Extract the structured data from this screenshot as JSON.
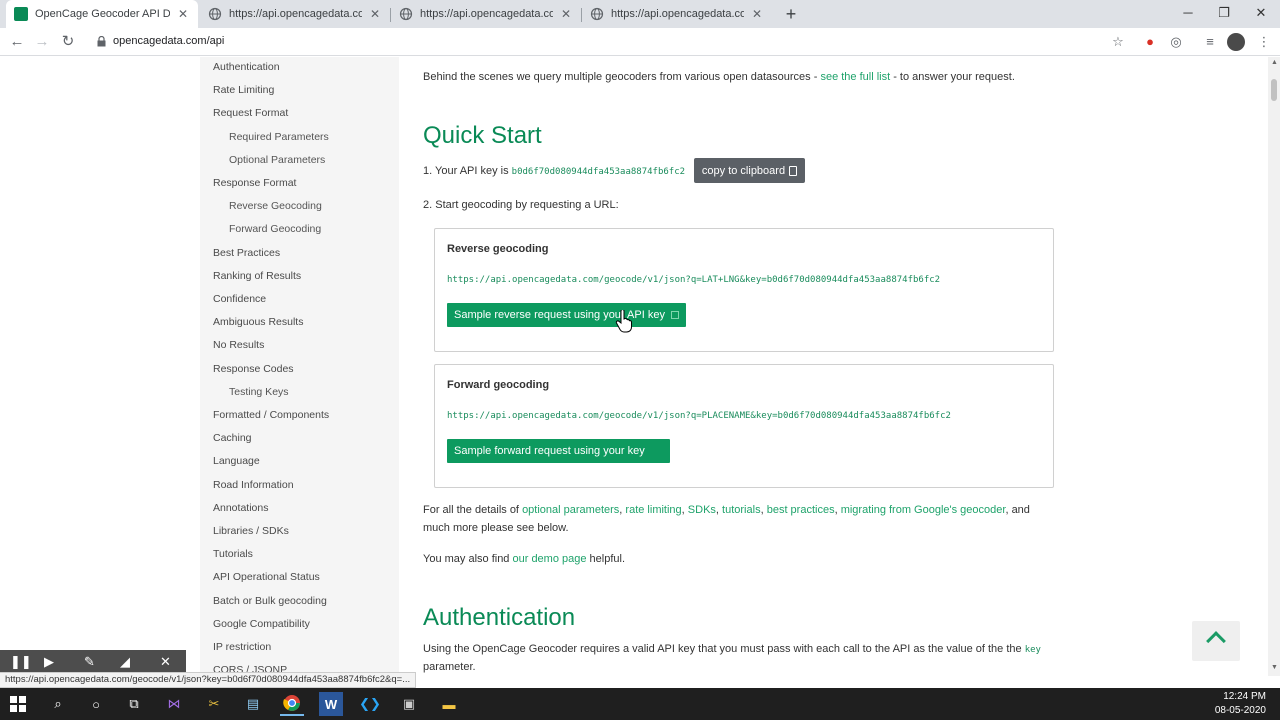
{
  "browser": {
    "tabs": [
      {
        "title": "OpenCage Geocoder API Docum",
        "active": true
      },
      {
        "title": "https://api.opencagedata.com/g",
        "active": false
      },
      {
        "title": "https://api.opencagedata.com/g",
        "active": false
      },
      {
        "title": "https://api.opencagedata.com/g",
        "active": false
      }
    ],
    "url": "opencagedata.com/api",
    "status_url": "https://api.opencagedata.com/geocode/v1/json?key=b0d6f70d080944dfa453aa8874fb6fc2&q=..."
  },
  "sidebar": {
    "items": [
      {
        "label": "Authentication",
        "sub": false
      },
      {
        "label": "Rate Limiting",
        "sub": false
      },
      {
        "label": "Request Format",
        "sub": false
      },
      {
        "label": "Required Parameters",
        "sub": true
      },
      {
        "label": "Optional Parameters",
        "sub": true
      },
      {
        "label": "Response Format",
        "sub": false
      },
      {
        "label": "Reverse Geocoding",
        "sub": true
      },
      {
        "label": "Forward Geocoding",
        "sub": true
      },
      {
        "label": "Best Practices",
        "sub": false
      },
      {
        "label": "Ranking of Results",
        "sub": false
      },
      {
        "label": "Confidence",
        "sub": false
      },
      {
        "label": "Ambiguous Results",
        "sub": false
      },
      {
        "label": "No Results",
        "sub": false
      },
      {
        "label": "Response Codes",
        "sub": false
      },
      {
        "label": "Testing Keys",
        "sub": true
      },
      {
        "label": "Formatted / Components",
        "sub": false
      },
      {
        "label": "Caching",
        "sub": false
      },
      {
        "label": "Language",
        "sub": false
      },
      {
        "label": "Road Information",
        "sub": false
      },
      {
        "label": "Annotations",
        "sub": false
      },
      {
        "label": "Libraries / SDKs",
        "sub": false
      },
      {
        "label": "Tutorials",
        "sub": false
      },
      {
        "label": "API Operational Status",
        "sub": false
      },
      {
        "label": "Batch or Bulk geocoding",
        "sub": false
      },
      {
        "label": "Google Compatibility",
        "sub": false
      },
      {
        "label": "IP restriction",
        "sub": false
      },
      {
        "label": "CORS / JSONP",
        "sub": false
      }
    ]
  },
  "intro": {
    "text": "Behind the scenes we query multiple geocoders from various open datasources - ",
    "link": "see the full list",
    "tail": " - to answer your request."
  },
  "quickstart": {
    "heading": "Quick Start",
    "step1_prefix": "1. Your API key is ",
    "api_key": "b0d6f70d080944dfa453aa8874fb6fc2",
    "copy_label": "copy to clipboard",
    "step2": "2. Start geocoding by requesting a URL:",
    "reverse": {
      "title": "Reverse geocoding",
      "url": "https://api.opencagedata.com/geocode/v1/json?q=LAT+LNG&key=b0d6f70d080944dfa453aa8874fb6fc2",
      "button": "Sample reverse request using your API key"
    },
    "forward": {
      "title": "Forward geocoding",
      "url": "https://api.opencagedata.com/geocode/v1/json?q=PLACENAME&key=b0d6f70d080944dfa453aa8874fb6fc2",
      "button": "Sample forward request using your key"
    }
  },
  "details": {
    "prefix": "For all the details of ",
    "links": [
      "optional parameters",
      "rate limiting",
      "SDKs",
      "tutorials",
      "best practices",
      "migrating from Google's geocoder"
    ],
    "suffix": ", and",
    "line2": "much more please see below."
  },
  "demo": {
    "prefix": "You may also find ",
    "link": "our demo page",
    "suffix": " helpful."
  },
  "authentication": {
    "heading": "Authentication",
    "text": "Using the OpenCage Geocoder requires a valid API key that you must pass with each call to the API as the value of the the ",
    "code": "key",
    "line2": "parameter."
  },
  "taskbar": {
    "time": "12:24 PM",
    "date": "08-05-2020"
  }
}
